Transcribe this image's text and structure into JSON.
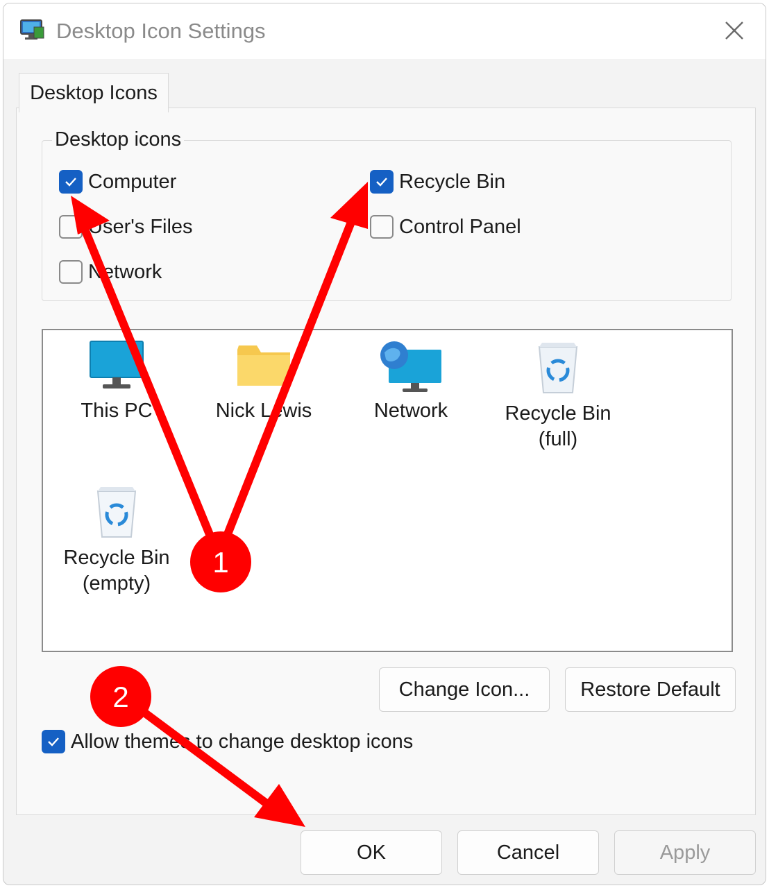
{
  "window": {
    "title": "Desktop Icon Settings",
    "icon": "monitor-settings-icon",
    "close_icon": "close-icon"
  },
  "tabs": [
    {
      "label": "Desktop Icons",
      "selected": true
    }
  ],
  "group": {
    "legend": "Desktop icons",
    "checkboxes": [
      {
        "label": "Computer",
        "checked": true
      },
      {
        "label": "User's Files",
        "checked": false
      },
      {
        "label": "Network",
        "checked": false
      },
      {
        "label": "Recycle Bin",
        "checked": true
      },
      {
        "label": "Control Panel",
        "checked": false
      }
    ]
  },
  "preview": {
    "items": [
      {
        "label": "This PC",
        "icon": "monitor-icon"
      },
      {
        "label": "Nick Lewis",
        "icon": "folder-icon"
      },
      {
        "label": "Network",
        "icon": "network-icon"
      },
      {
        "label": "Recycle Bin",
        "sublabel": "(full)",
        "icon": "recycle-bin-full-icon"
      },
      {
        "label": "Recycle Bin",
        "sublabel": "(empty)",
        "icon": "recycle-bin-empty-icon"
      }
    ]
  },
  "buttons": {
    "change_icon": "Change Icon...",
    "restore_default": "Restore Default",
    "ok": "OK",
    "cancel": "Cancel",
    "apply": "Apply"
  },
  "allow_themes": {
    "label": "Allow themes to change desktop icons",
    "checked": true
  },
  "annotations": {
    "badge_1": "1",
    "badge_2": "2",
    "color": "#ff0000"
  },
  "colors": {
    "accent": "#1560c4",
    "annotation": "#ff0000"
  }
}
